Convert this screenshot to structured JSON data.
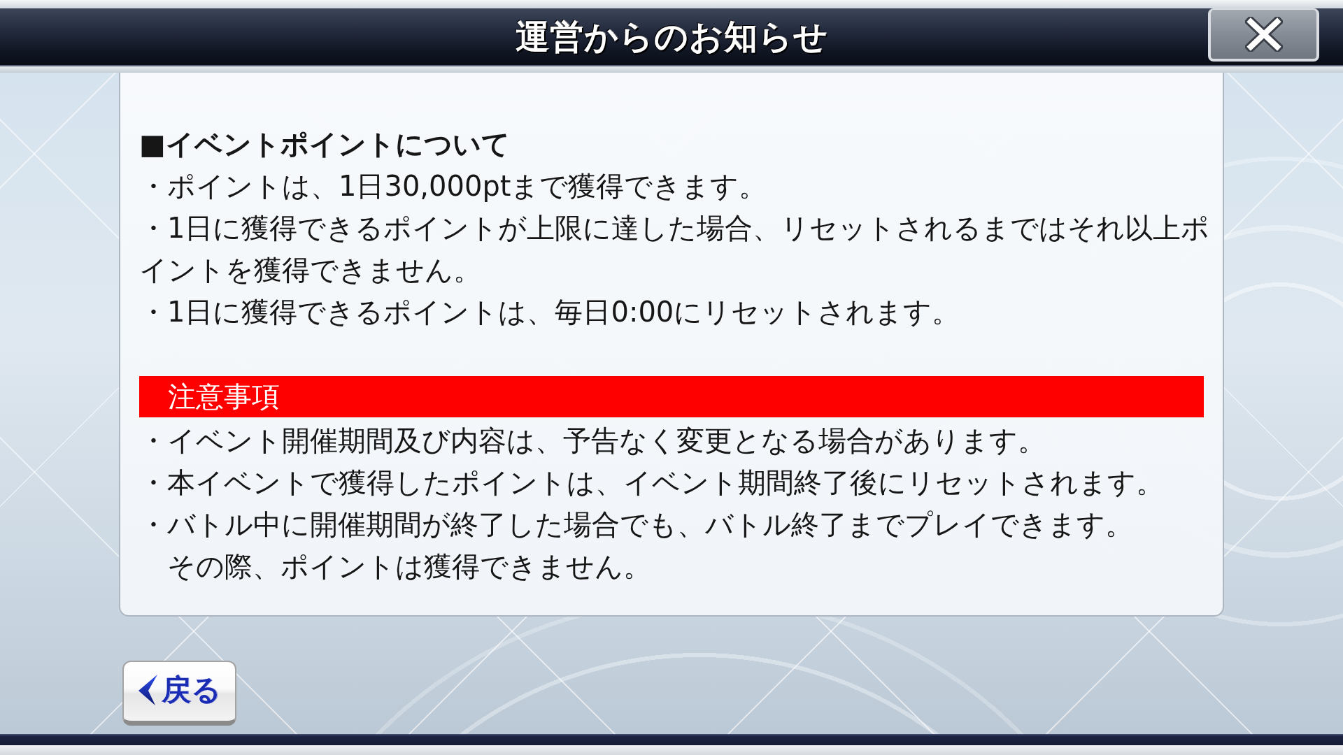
{
  "window": {
    "title": "運営からのお知らせ"
  },
  "notice": {
    "heading": "■イベントポイントについて",
    "points": [
      "・ポイントは、1日30,000ptまで獲得できます。",
      "・1日に獲得できるポイントが上限に達した場合、リセットされるまではそれ以上ポイントを獲得できません。",
      "・1日に獲得できるポイントは、毎日0:00にリセットされます。"
    ]
  },
  "caution": {
    "title": "注意事項",
    "lines": [
      {
        "kind": "bullet",
        "text": "・イベント開催期間及び内容は、予告なく変更となる場合があります。"
      },
      {
        "kind": "bullet",
        "text": "・本イベントで獲得したポイントは、イベント期間終了後にリセットされます。"
      },
      {
        "kind": "bullet",
        "text": "・バトル中に開催期間が終了した場合でも、バトル終了までプレイできます。"
      },
      {
        "kind": "continuation",
        "text": "その際、ポイントは獲得できません。"
      }
    ]
  },
  "back_button": {
    "label": "戻る"
  }
}
